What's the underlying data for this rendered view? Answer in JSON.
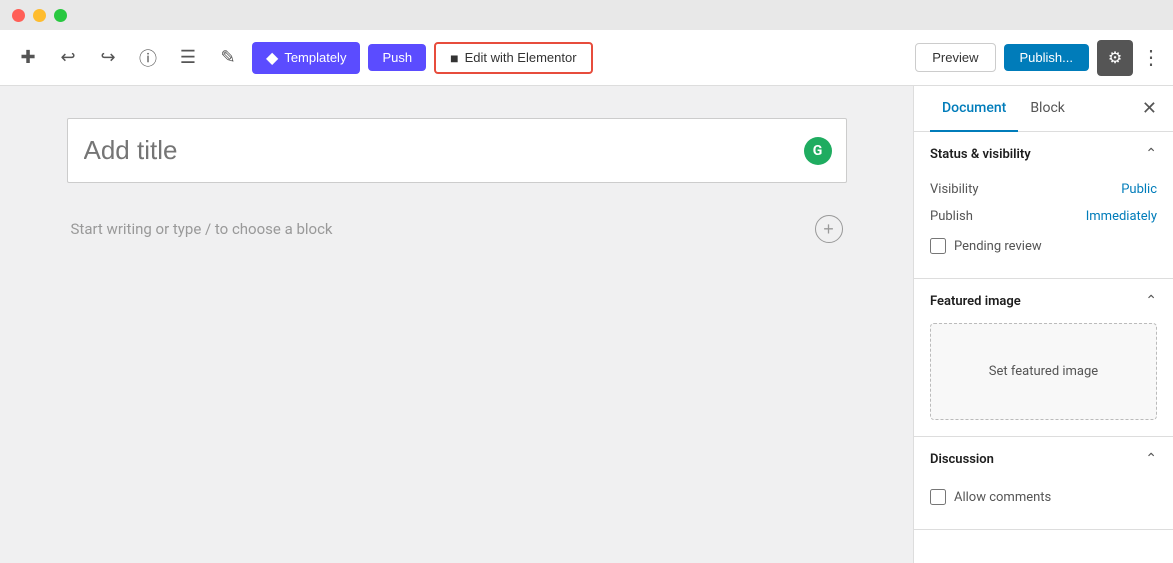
{
  "titlebar": {
    "dots": [
      "red",
      "yellow",
      "green"
    ]
  },
  "toolbar": {
    "undo_icon": "↩",
    "redo_icon": "↪",
    "info_icon": "ℹ",
    "list_icon": "☰",
    "pen_icon": "✏",
    "templately_label": "Templately",
    "push_label": "Push",
    "elementor_label": "Edit with Elementor",
    "preview_label": "Preview",
    "publish_label": "Publish...",
    "settings_icon": "⚙",
    "more_icon": "⋮"
  },
  "editor": {
    "title_placeholder": "Add title",
    "content_placeholder": "Start writing or type / to choose a block",
    "grammarly_letter": "G"
  },
  "sidebar": {
    "tabs": [
      {
        "label": "Document",
        "active": true
      },
      {
        "label": "Block",
        "active": false
      }
    ],
    "close_icon": "✕",
    "sections": {
      "status_visibility": {
        "title": "Status & visibility",
        "visibility_label": "Visibility",
        "visibility_value": "Public",
        "publish_label": "Publish",
        "publish_value": "Immediately",
        "pending_review_label": "Pending review"
      },
      "featured_image": {
        "title": "Featured image",
        "set_image_label": "Set featured image"
      },
      "discussion": {
        "title": "Discussion",
        "allow_comments_label": "Allow comments"
      }
    }
  }
}
